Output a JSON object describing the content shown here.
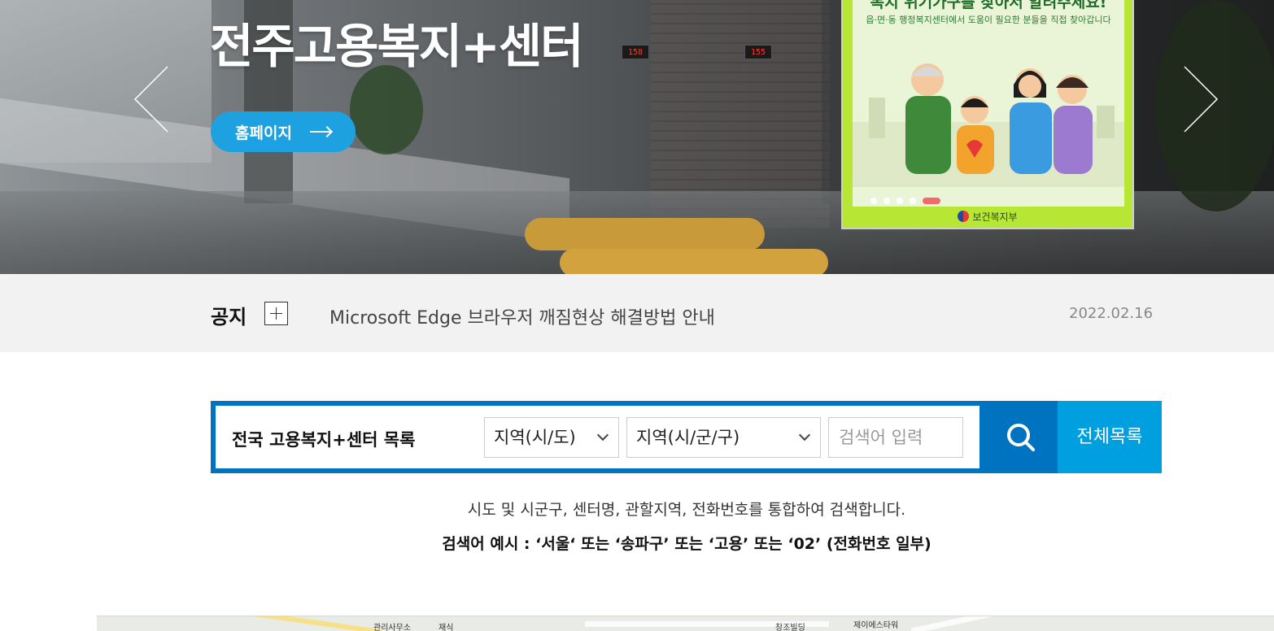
{
  "hero": {
    "title": "전주고용복지+센터",
    "home_button": "홈페이지",
    "queue_displays": [
      "158",
      "155"
    ]
  },
  "banner": {
    "headline": "복지 위기가구를 찾아서 알려주세요!",
    "subtext": "읍·면·동 행정복지센터에서 도움이 필요한 분들을 직접 찾아갑니다",
    "ministry": "보건복지부",
    "slides_total": 5,
    "active_slide": 5
  },
  "notice": {
    "label": "공지",
    "text": "Microsoft Edge 브라우저 깨짐현상 해결방법 안내",
    "date": "2022.02.16"
  },
  "search": {
    "title": "전국 고용복지+센터 목록",
    "region_sido": "지역(시/도)",
    "region_sigungu": "지역(시/군/구)",
    "placeholder": "검색어 입력",
    "all_list_button": "전체목록",
    "help_line_1": "시도 및 시군구, 센터명, 관할지역, 전화번호를 통합하여 검색합니다.",
    "help_line_2": "검색어 예시 : ‘서울‘ 또는 ‘송파구’ 또는 ‘고용’ 또는 ‘02’ (전화번호 일부)"
  },
  "map": {
    "labels": [
      "관리사무소",
      "재식",
      "창조빌딩",
      "제이에스타워"
    ]
  },
  "colors": {
    "primary_blue": "#0073c0",
    "sky_blue": "#00a0e0",
    "home_button": "#1ea1e0",
    "banner_green": "#b8e635",
    "notice_bg": "#f2f2f2"
  }
}
